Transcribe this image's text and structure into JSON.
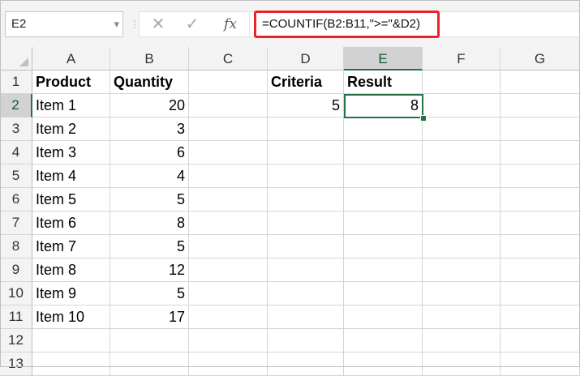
{
  "name_box": "E2",
  "formula": "=COUNTIF(B2:B11,\">=\"&D2)",
  "formula_buttons": {
    "cancel_icon": "✕",
    "enter_icon": "✓",
    "function_icon": "fx"
  },
  "columns": [
    "A",
    "B",
    "C",
    "D",
    "E",
    "F",
    "G"
  ],
  "rows": [
    "1",
    "2",
    "3",
    "4",
    "5",
    "6",
    "7",
    "8",
    "9",
    "10",
    "11",
    "12",
    "13"
  ],
  "selected": {
    "column": "E",
    "row": "2"
  },
  "cells": {
    "A1": "Product",
    "B1": "Quantity",
    "D1": "Criteria",
    "E1": "Result",
    "A2": "Item 1",
    "B2": "20",
    "D2": "5",
    "E2": "8",
    "A3": "Item 2",
    "B3": "3",
    "A4": "Item 3",
    "B4": "6",
    "A5": "Item 4",
    "B5": "4",
    "A6": "Item 5",
    "B6": "5",
    "A7": "Item 6",
    "B7": "8",
    "A8": "Item 7",
    "B8": "5",
    "A9": "Item 8",
    "B9": "12",
    "A10": "Item 9",
    "B10": "5",
    "A11": "Item 10",
    "B11": "17"
  },
  "accent_color": "#217346",
  "highlight_color": "#e8242a"
}
